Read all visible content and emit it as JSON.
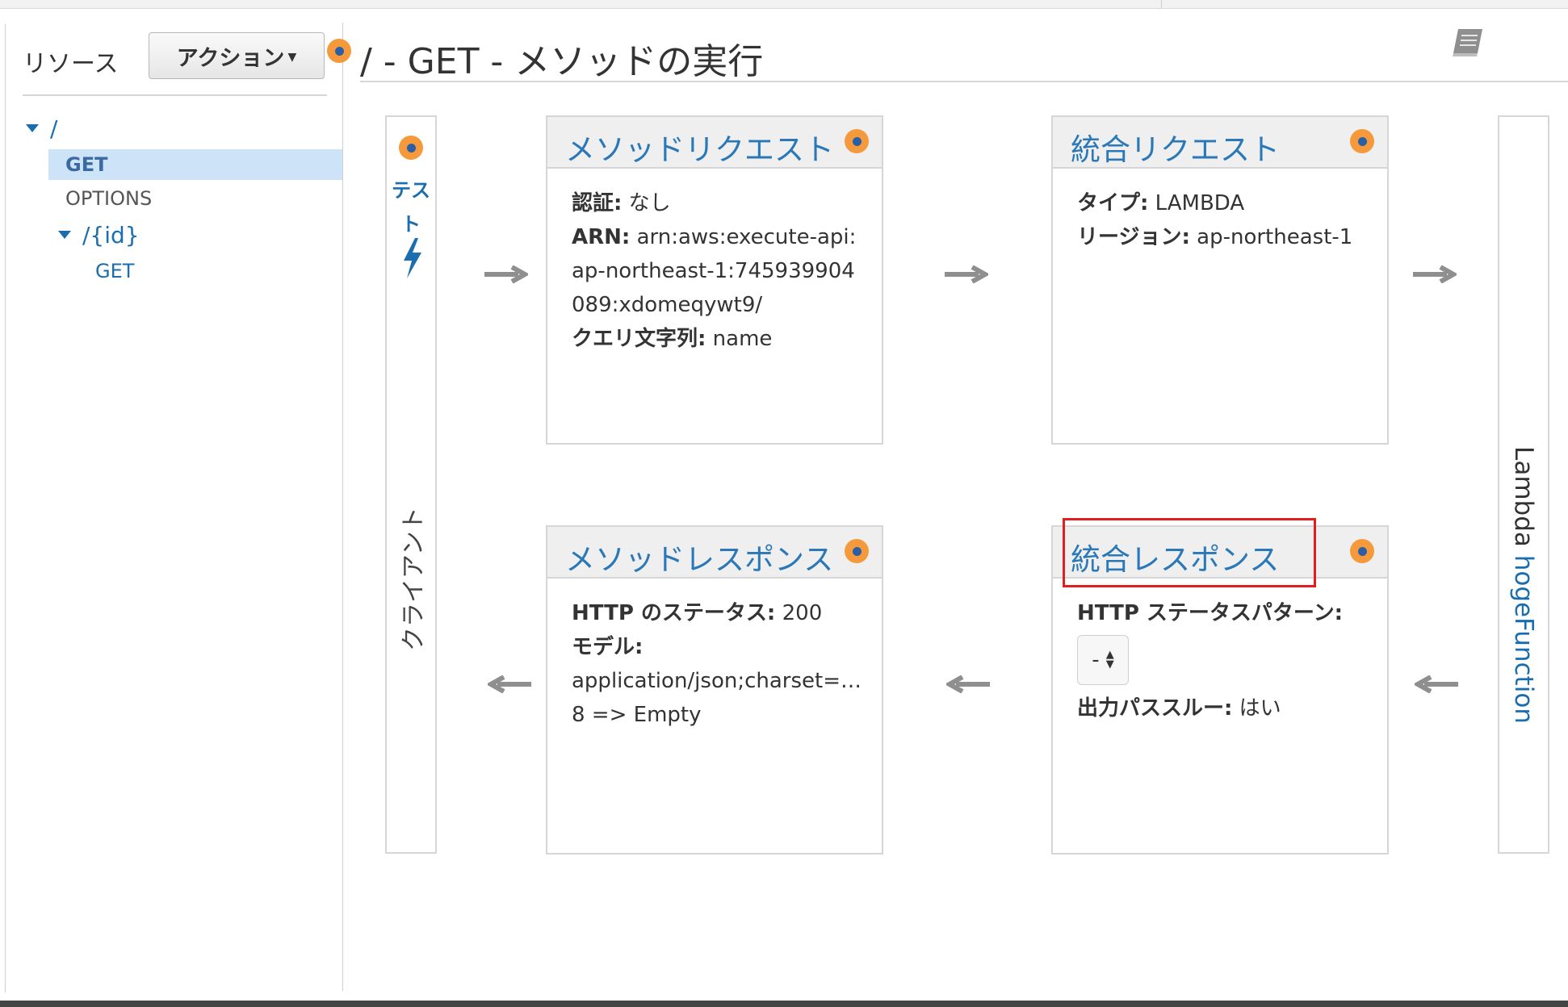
{
  "header": {
    "title": "/ - GET - メソッドの実行",
    "book_icon": "book-icon"
  },
  "sidebar": {
    "resources_label": "リソース",
    "actions_label": "アクション",
    "tree": {
      "root": "/",
      "root_methods": [
        "GET",
        "OPTIONS"
      ],
      "child": "/{id}",
      "child_methods": [
        "GET"
      ],
      "selected": "GET"
    }
  },
  "client": {
    "test_label_line1": "テス",
    "test_label_line2": "ト",
    "label": "クライアント",
    "bolt_icon": "lightning-icon"
  },
  "lambda": {
    "prefix": "Lambda ",
    "function_name": "hogeFunction"
  },
  "method_request": {
    "title": "メソッドリクエスト",
    "auth_label": "認証:",
    "auth_value": "なし",
    "arn_label": "ARN:",
    "arn_value": "arn:aws:execute-api:ap-northeast-1:745939904089:xdomeqywt9/",
    "query_label": "クエリ文字列:",
    "query_value": "name"
  },
  "integration_request": {
    "title": "統合リクエスト",
    "type_label": "タイプ:",
    "type_value": "LAMBDA",
    "region_label": "リージョン:",
    "region_value": "ap-northeast-1"
  },
  "method_response": {
    "title": "メソッドレスポンス",
    "status_label": "HTTP のステータス:",
    "status_value": "200",
    "model_label": "モデル:",
    "model_value_line1": "application/json;charset=UT…",
    "model_value_line2": "8 => Empty"
  },
  "integration_response": {
    "title": "統合レスポンス",
    "pattern_label": "HTTP ステータスパターン:",
    "pattern_value": "-",
    "passthrough_label": "出力パススルー:",
    "passthrough_value": "はい"
  },
  "colors": {
    "link": "#1a6eb0",
    "title_blue": "#2b78b8",
    "info_dot": "#f59a3c",
    "highlight": "#e02020",
    "selected_bg": "#cde3f8"
  }
}
